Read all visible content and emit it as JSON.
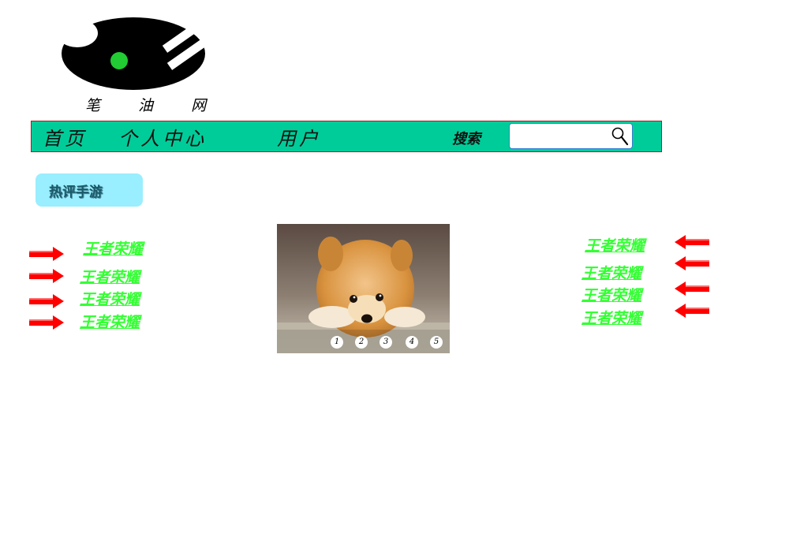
{
  "logo": {
    "text": "笔 油 网",
    "accent_color": "#22cc33"
  },
  "nav": {
    "background": "#00cc99",
    "items": [
      {
        "label": "首页"
      },
      {
        "label": "个人中心"
      },
      {
        "label": "用户"
      }
    ],
    "search_label": "搜索",
    "search_value": "",
    "search_icon": "magnifier-icon"
  },
  "section": {
    "title": "热评手游",
    "background": "#99eeff"
  },
  "left_links": [
    {
      "label": "王者荣耀"
    },
    {
      "label": "王者荣耀"
    },
    {
      "label": "王者荣耀"
    },
    {
      "label": "王者荣耀"
    }
  ],
  "right_links": [
    {
      "label": "王者荣耀"
    },
    {
      "label": "王者荣耀"
    },
    {
      "label": "王者荣耀"
    },
    {
      "label": "王者荣耀"
    }
  ],
  "link_color": "#33ff33",
  "arrow_color": "#ff0000",
  "carousel": {
    "image": "pomeranian-puppy",
    "indicators": [
      "1",
      "2",
      "3",
      "4",
      "5"
    ]
  }
}
